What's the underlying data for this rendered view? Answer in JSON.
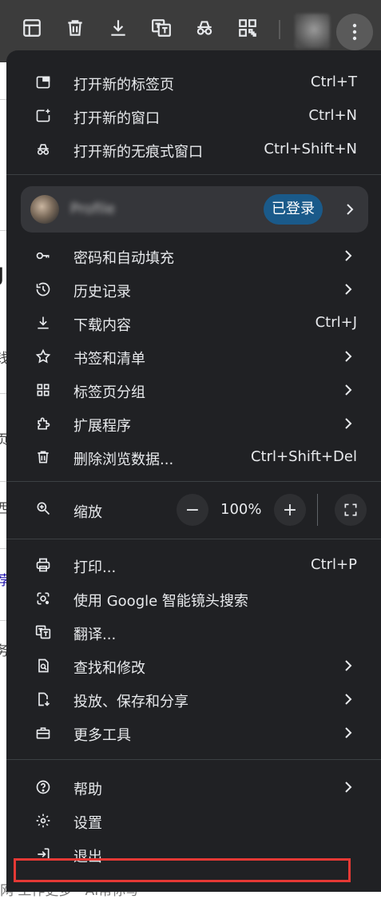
{
  "toolbar": {
    "icons": [
      "side-panel-icon",
      "delete-icon",
      "download-icon",
      "translate-icon",
      "incognito-icon",
      "qr-code-icon"
    ],
    "more_icon": "three-dot-menu-icon"
  },
  "background": {
    "fragments": [
      "J",
      "钱",
      "页",
      "西",
      "荐",
      "务"
    ],
    "bottom_text": "网 工作更多 · AI帮你写"
  },
  "menu": {
    "group1": [
      {
        "label": "打开新的标签页",
        "shortcut": "Ctrl+T",
        "icon": "new-tab-icon"
      },
      {
        "label": "打开新的窗口",
        "shortcut": "Ctrl+N",
        "icon": "new-window-icon"
      },
      {
        "label": "打开新的无痕式窗口",
        "shortcut": "Ctrl+Shift+N",
        "icon": "incognito-icon"
      }
    ],
    "profile": {
      "name": "Profile",
      "badge": "已登录"
    },
    "group2": [
      {
        "label": "密码和自动填充",
        "icon": "key-icon",
        "submenu": true
      },
      {
        "label": "历史记录",
        "icon": "history-icon",
        "submenu": true
      },
      {
        "label": "下载内容",
        "shortcut": "Ctrl+J",
        "icon": "download-icon"
      },
      {
        "label": "书签和清单",
        "icon": "star-icon",
        "submenu": true
      },
      {
        "label": "标签页分组",
        "icon": "grid-icon",
        "submenu": true
      },
      {
        "label": "扩展程序",
        "icon": "puzzle-icon",
        "submenu": true
      },
      {
        "label": "删除浏览数据...",
        "shortcut": "Ctrl+Shift+Del",
        "icon": "trash-icon"
      }
    ],
    "zoom": {
      "label": "缩放",
      "value": "100%",
      "minus": "−",
      "plus": "+"
    },
    "group3": [
      {
        "label": "打印...",
        "shortcut": "Ctrl+P",
        "icon": "print-icon"
      },
      {
        "label": "使用 Google 智能镜头搜索",
        "icon": "lens-icon"
      },
      {
        "label": "翻译...",
        "icon": "translate-icon"
      },
      {
        "label": "查找和修改",
        "icon": "find-icon",
        "submenu": true
      },
      {
        "label": "投放、保存和分享",
        "icon": "save-share-icon",
        "submenu": true
      },
      {
        "label": "更多工具",
        "icon": "toolbox-icon",
        "submenu": true
      }
    ],
    "group4": [
      {
        "label": "帮助",
        "icon": "help-icon",
        "submenu": true
      },
      {
        "label": "设置",
        "icon": "settings-icon"
      },
      {
        "label": "退出",
        "icon": "exit-icon"
      }
    ]
  },
  "colors": {
    "menu_bg": "#202124",
    "text": "#e8eaed",
    "badge": "#1a5a8a",
    "highlight": "#e53935"
  }
}
